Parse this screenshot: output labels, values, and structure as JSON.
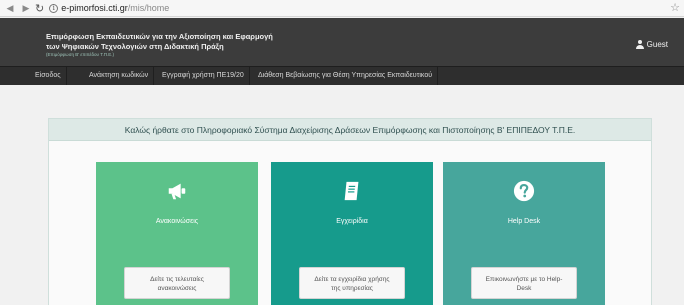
{
  "browser": {
    "back_icon": "arrow-left-icon",
    "forward_icon": "arrow-right-icon",
    "reload_icon": "reload-icon",
    "url_domain": "e-pimorfosi.cti.gr",
    "url_path": "/mis/home",
    "bookmark_icon": "star-icon"
  },
  "header": {
    "title_line1": "Επιμόρφωση Εκπαιδευτικών για την Αξιοποίηση και Εφαρμογή",
    "title_line2": "των Ψηφιακών Τεχνολογιών στη Διδακτική Πράξη",
    "subtitle": "(Επιμόρφωση Β' επιπέδου Τ.Π.Ε.)",
    "user_label": "Guest",
    "background": "#3c3c3c"
  },
  "nav": {
    "items": [
      {
        "label": "Είσοδος"
      },
      {
        "label": "Ανάκτηση κωδικών"
      },
      {
        "label": "Εγγραφή χρήστη ΠΕ19/20"
      },
      {
        "label": "Διάθεση Βεβαίωσης για Θέση Υπηρεσίας Εκπαιδευτικού"
      }
    ]
  },
  "main": {
    "welcome": "Καλώς ήρθατε στο Πληροφοριακό Σύστημα Διαχείρισης Δράσεων Επιμόρφωσης και Πιστοποίησης Β' ΕΠΙΠΕΔΟΥ Τ.Π.Ε.",
    "cards": [
      {
        "title": "Ανακοινώσεις",
        "icon": "megaphone-icon",
        "button_line1": "Δείτε τις τελευταίες",
        "button_line2": "ανακοινώσεις",
        "color": "#5cc28a"
      },
      {
        "title": "Εγχειρίδια",
        "icon": "book-icon",
        "button_line1": "Δείτε τα εγχειρίδια χρήσης",
        "button_line2": "της υπηρεσίας",
        "color": "#169b8c"
      },
      {
        "title": "Help Desk",
        "icon": "question-icon",
        "button_line1": "Επικοινωνήστε με το Help-",
        "button_line2": "Desk",
        "color": "#47a69c"
      }
    ]
  }
}
